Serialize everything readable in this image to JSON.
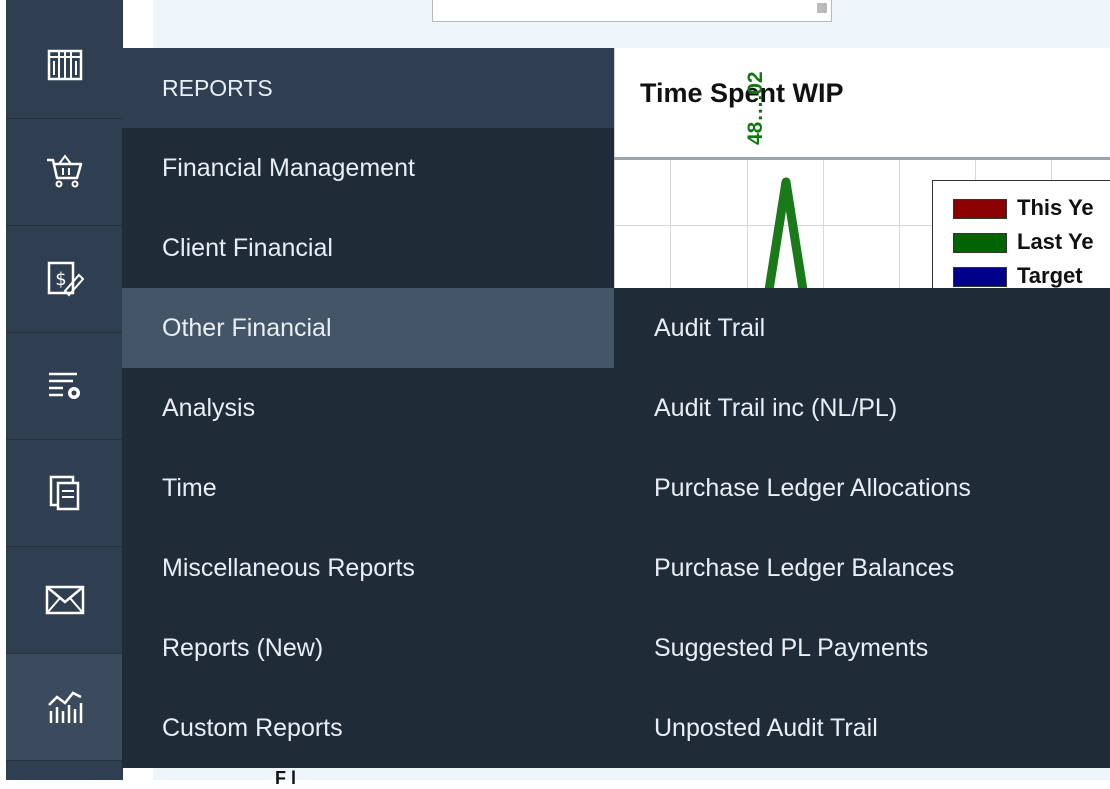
{
  "chart": {
    "title": "Time Spent WIP",
    "peak_label": "48….02",
    "legend": [
      {
        "label": "This Ye",
        "color": "#8b0000"
      },
      {
        "label": "Last Ye",
        "color": "#006400"
      },
      {
        "label": "Target",
        "color": "#00008b"
      }
    ],
    "line_color": "#1a7a1a"
  },
  "background": {
    "bottom_text": "F l"
  },
  "rail": {
    "icons": [
      "library-icon",
      "cart-icon",
      "invoice-icon",
      "settings-list-icon",
      "documents-icon",
      "mail-icon",
      "reports-chart-icon"
    ],
    "active_index": 6
  },
  "menu": {
    "header": "REPORTS",
    "items": [
      "Financial Management",
      "Client Financial",
      "Other Financial",
      "Analysis",
      "Time",
      "Miscellaneous Reports",
      "Reports (New)",
      "Custom Reports"
    ],
    "active_index": 2
  },
  "submenu": {
    "items": [
      "Audit Trail",
      "Audit Trail inc (NL/PL)",
      "Purchase Ledger Allocations",
      "Purchase Ledger Balances",
      "Suggested PL Payments",
      "Unposted Audit Trail"
    ]
  },
  "colors": {
    "rail_bg": "#2f3e50",
    "menu_bg": "#202b38",
    "menu_active": "#445567",
    "menu_text": "#e8eef5"
  }
}
